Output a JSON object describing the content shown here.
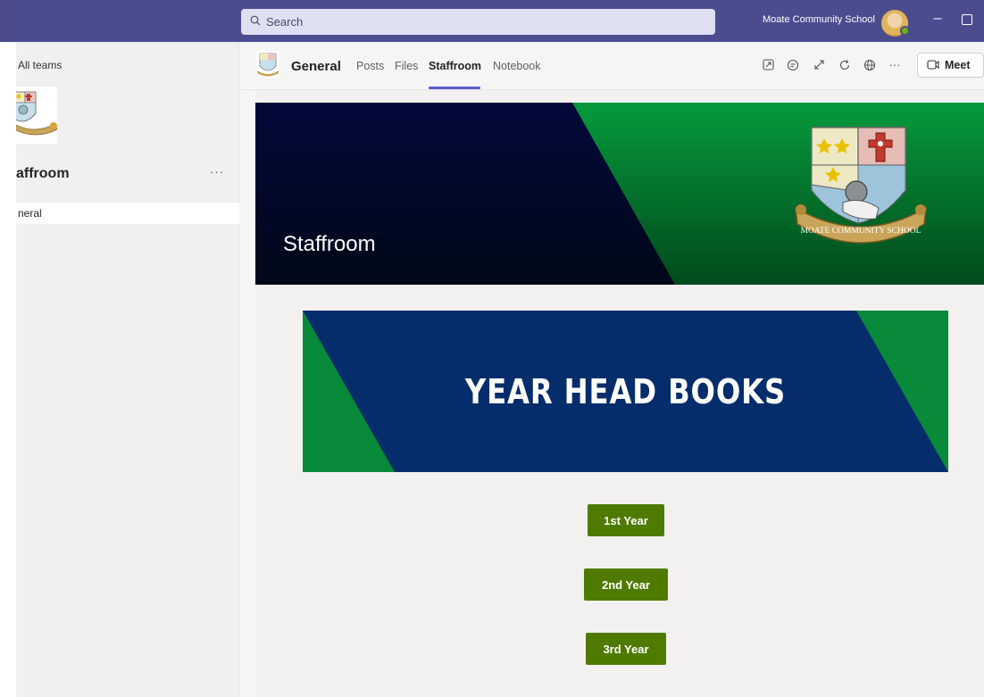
{
  "titlebar": {
    "search_placeholder": "Search",
    "org_name": "Moate Community School"
  },
  "sidebar": {
    "back_label": "All teams",
    "team_name": "affroom",
    "more_label": "···",
    "channels": [
      {
        "label": "neral"
      }
    ]
  },
  "channel_header": {
    "title": "General",
    "tabs": [
      {
        "label": "Posts"
      },
      {
        "label": "Files"
      },
      {
        "label": "Staffroom"
      },
      {
        "label": "Notebook"
      }
    ],
    "more_label": "···",
    "meet_label": "Meet"
  },
  "content": {
    "hero_title": "Staffroom",
    "crest_text": "MOATE COMMUNITY SCHOOL",
    "banner_title": "YEAR HEAD BOOKS",
    "buttons": [
      {
        "label": "1st Year"
      },
      {
        "label": "2nd Year"
      },
      {
        "label": "3rd Year"
      }
    ]
  },
  "colors": {
    "titlebar": "#4b4c8e",
    "button_green": "#4f7a00",
    "banner_navy": "#052d6b",
    "banner_green": "#098a3a",
    "hero_navy": "#030a2c",
    "hero_green": "#03903a"
  }
}
